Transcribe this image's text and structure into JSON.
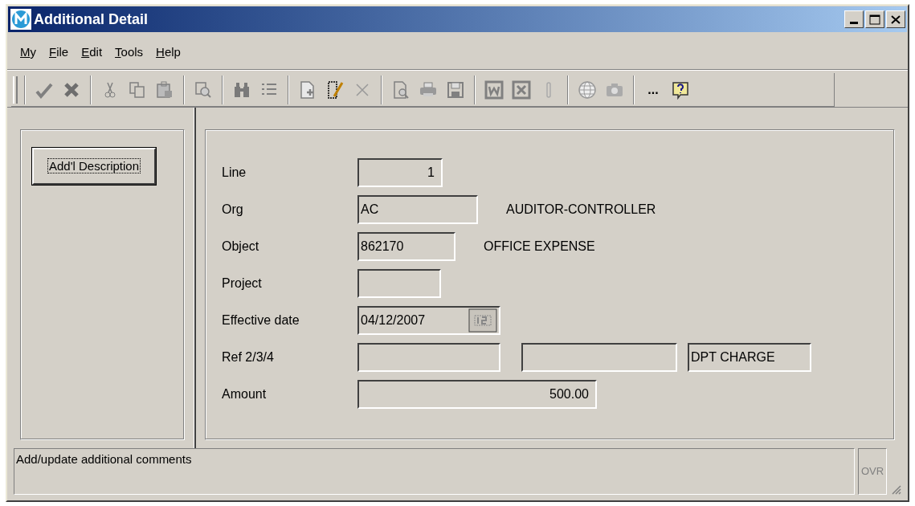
{
  "window": {
    "title": "Additional Detail"
  },
  "menu": [
    "My",
    "File",
    "Edit",
    "Tools",
    "Help"
  ],
  "toolbar": [
    [
      {
        "kind": "grip"
      }
    ],
    [
      {
        "kind": "check"
      },
      {
        "kind": "x"
      }
    ],
    [
      {
        "kind": "cut"
      },
      {
        "kind": "copy"
      },
      {
        "kind": "paste"
      }
    ],
    [
      {
        "kind": "zoom-doc"
      }
    ],
    [
      {
        "kind": "binoculars"
      },
      {
        "kind": "list"
      }
    ],
    [
      {
        "kind": "new-doc"
      },
      {
        "kind": "edit-doc"
      },
      {
        "kind": "delete"
      }
    ],
    [
      {
        "kind": "preview"
      },
      {
        "kind": "print"
      },
      {
        "kind": "save"
      }
    ],
    [
      {
        "kind": "word"
      },
      {
        "kind": "excel"
      },
      {
        "kind": "clip"
      }
    ],
    [
      {
        "kind": "globe"
      },
      {
        "kind": "camera"
      }
    ],
    [
      {
        "kind": "text",
        "label": "..."
      },
      {
        "kind": "help"
      }
    ]
  ],
  "side_buttons": [
    "Add'l Description"
  ],
  "form": [
    {
      "label": "Line",
      "fields": [
        {
          "value": "1",
          "kind": "number"
        }
      ]
    },
    {
      "label": "Org",
      "fields": [
        {
          "value": "AC",
          "kind": "text"
        }
      ],
      "description": "AUDITOR-CONTROLLER"
    },
    {
      "label": "Object",
      "fields": [
        {
          "value": "862170",
          "kind": "text"
        }
      ],
      "description": "OFFICE EXPENSE"
    },
    {
      "label": "Project",
      "fields": [
        {
          "kind": "text"
        }
      ]
    },
    {
      "label": "Effective date",
      "fields": [
        {
          "value": "04/12/2007",
          "kind": "date"
        }
      ]
    },
    {
      "label": "Ref 2/3/4",
      "fields": [
        {
          "kind": "text"
        },
        {
          "kind": "text"
        },
        {
          "value": "DPT CHARGE",
          "kind": "text"
        }
      ]
    },
    {
      "label": "Amount",
      "fields": [
        {
          "value": "500.00",
          "kind": "number"
        }
      ]
    }
  ],
  "status_bar": {
    "message": "Add/update additional comments",
    "mode": "OVR"
  }
}
